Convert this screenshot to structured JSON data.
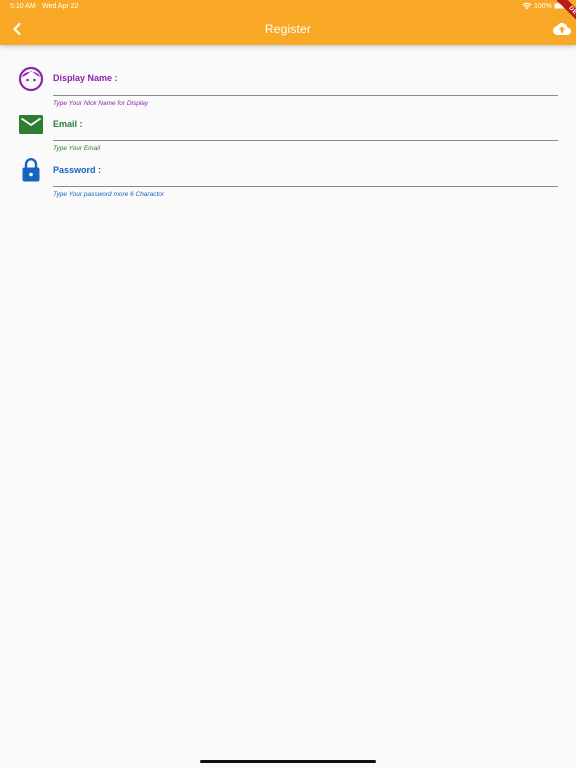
{
  "status_bar": {
    "time": "5:10 AM",
    "date": "Wed Apr 22",
    "battery": "100%"
  },
  "app_bar": {
    "title": "Register",
    "debug_banner": "DEBUG",
    "back_icon": "chevron-left-icon",
    "action_icon": "cloud-upload-icon"
  },
  "colors": {
    "app_bar": "#f9a825",
    "display_name": "#8e24aa",
    "email": "#2e7d32",
    "password": "#1565c0"
  },
  "form": {
    "display_name": {
      "label": "Display Name :",
      "value": "",
      "helper": "Type Your Nick Name for Display",
      "icon": "face-icon"
    },
    "email": {
      "label": "Email :",
      "value": "",
      "helper": "Type Your Email",
      "icon": "email-icon"
    },
    "password": {
      "label": "Password :",
      "value": "",
      "helper": "Type Your password more 6 Charactor",
      "icon": "lock-icon"
    }
  }
}
